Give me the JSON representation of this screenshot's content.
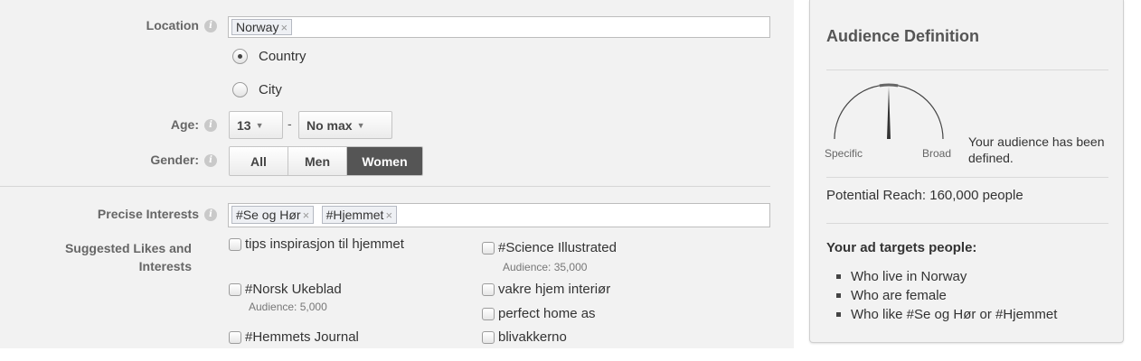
{
  "form": {
    "location": {
      "label": "Location",
      "tokens": [
        "Norway"
      ],
      "radios": [
        {
          "label": "Country",
          "checked": true
        },
        {
          "label": "City",
          "checked": false
        }
      ]
    },
    "age": {
      "label": "Age:",
      "min": "13",
      "separator": "-",
      "max": "No max"
    },
    "gender": {
      "label": "Gender:",
      "options": [
        "All",
        "Men",
        "Women"
      ],
      "selected": "Women"
    },
    "precise_interests": {
      "label": "Precise Interests",
      "tokens": [
        "#Se og Hør",
        "#Hjemmet"
      ]
    },
    "suggested": {
      "label_line1": "Suggested Likes and",
      "label_line2": "Interests",
      "items": [
        {
          "label": "tips inspirasjon til hjemmet",
          "audience": ""
        },
        {
          "label": "#Norsk Ukeblad",
          "audience": "Audience: 5,000"
        },
        {
          "label": "#Hemmets Journal",
          "audience": ""
        },
        {
          "label": "#Science Illustrated",
          "audience": "Audience: 35,000"
        },
        {
          "label": "vakre hjem interiør",
          "audience": ""
        },
        {
          "label": "perfect home as",
          "audience": ""
        },
        {
          "label": "blivakkerno",
          "audience": ""
        }
      ]
    },
    "token_remove_glyph": "×",
    "caret_glyph": "▼"
  },
  "audience": {
    "title": "Audience Definition",
    "gauge": {
      "left_label": "Specific",
      "right_label": "Broad",
      "level": 0.5
    },
    "status": "Your audience has been defined.",
    "reach": "Potential Reach: 160,000 people",
    "targets_title": "Your ad targets people:",
    "targets": [
      "Who live in Norway",
      "Who are female",
      "Who like #Se og Hør or #Hjemmet"
    ]
  },
  "colors": {
    "active_button": "#555555",
    "panel_bg": "#f2f2f2"
  }
}
